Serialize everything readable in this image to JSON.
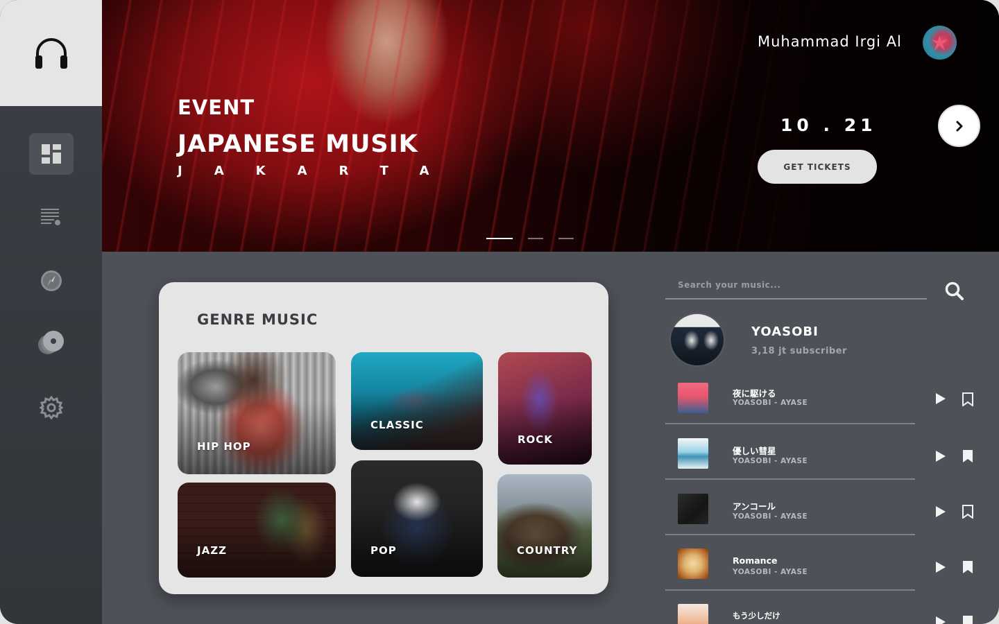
{
  "user": {
    "name": "Muhammad Irgi Al"
  },
  "hero": {
    "kicker": "EVENT",
    "title": "JAPANESE MUSIK",
    "city": "JAKARTA",
    "date": "10 . 21",
    "cta_label": "GET TICKETS"
  },
  "genres": {
    "title": "GENRE MUSIC",
    "items": [
      {
        "label": "HIP HOP"
      },
      {
        "label": "CLASSIC"
      },
      {
        "label": "ROCK"
      },
      {
        "label": "JAZZ"
      },
      {
        "label": "POP"
      },
      {
        "label": "COUNTRY"
      }
    ]
  },
  "search": {
    "placeholder": "Search your music..."
  },
  "artist": {
    "name": "YOASOBI",
    "subscribers": "3,18 jt subscriber"
  },
  "songs": [
    {
      "title": "夜に駆ける",
      "artist": "YOASOBI - AYASE",
      "saved": false
    },
    {
      "title": "優しい彗星",
      "artist": "YOASOBI - AYASE",
      "saved": true
    },
    {
      "title": "アンコール",
      "artist": "YOASOBI - AYASE",
      "saved": false
    },
    {
      "title": "Romance",
      "artist": "YOASOBI - AYASE",
      "saved": true
    },
    {
      "title": "もう少しだけ",
      "artist": "",
      "saved": true
    }
  ],
  "carousel": {
    "count": 3,
    "active": 1
  },
  "colors": {
    "sidebar": "#32353a",
    "panel": "#4e5258",
    "card": "#e5e5e5",
    "accent": "#ffffff"
  },
  "icons": {
    "logo": "headphones-icon",
    "nav": [
      "dashboard-icon",
      "playlist-icon",
      "compass-icon",
      "vinyl-icon",
      "gear-icon"
    ]
  }
}
